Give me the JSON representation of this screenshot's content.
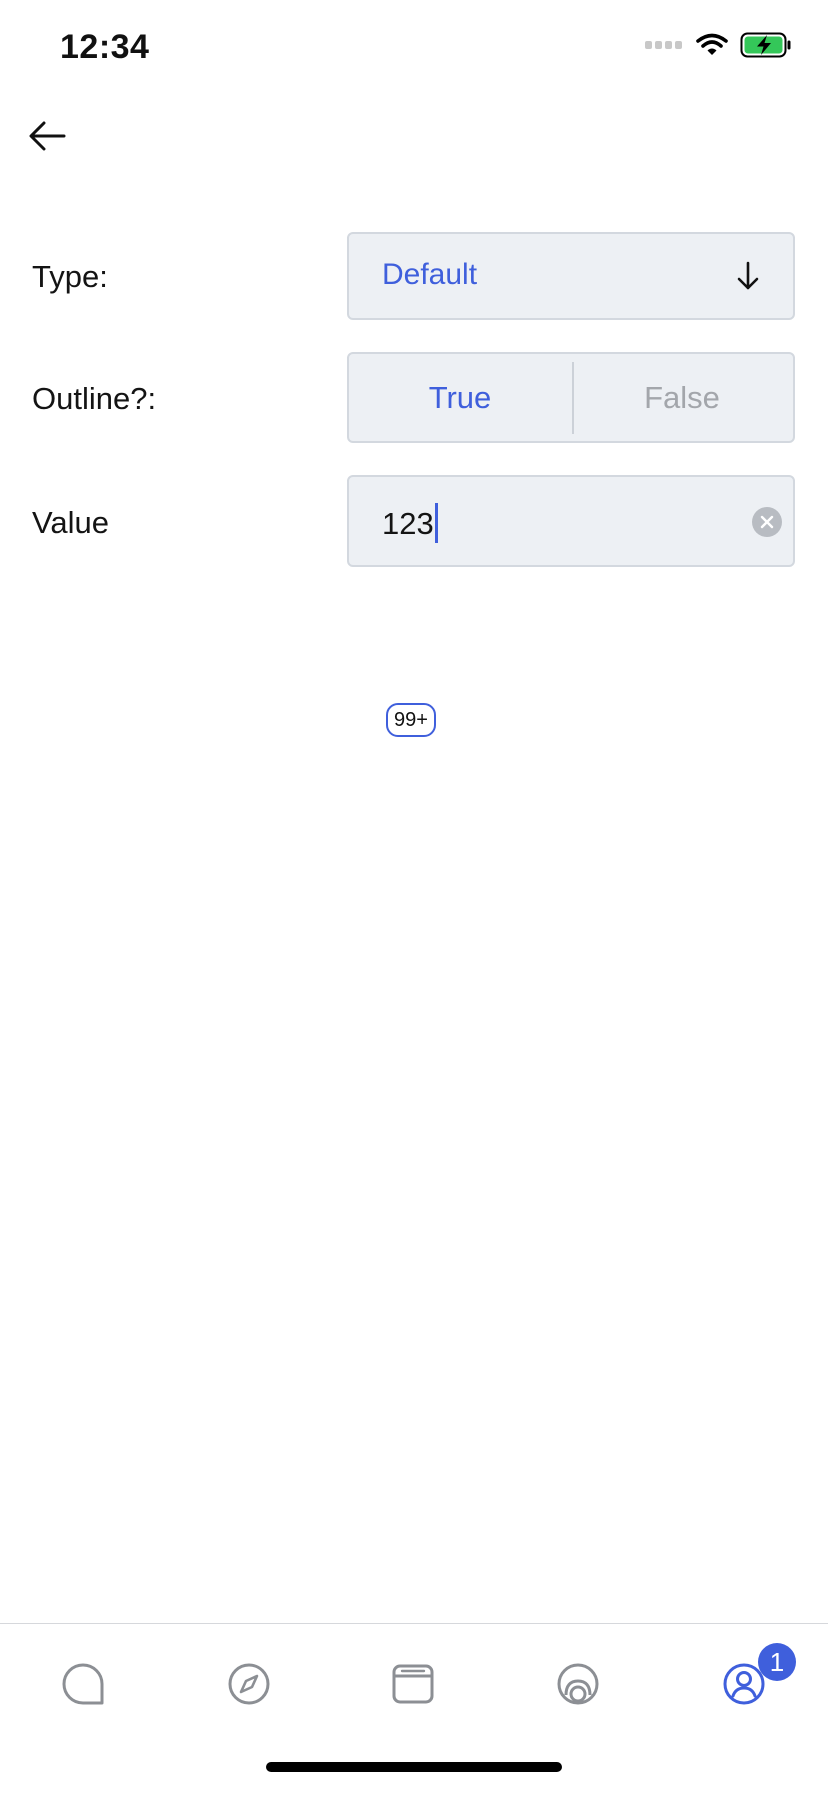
{
  "status_bar": {
    "time": "12:34"
  },
  "form": {
    "type": {
      "label": "Type:",
      "value": "Default"
    },
    "outline": {
      "label": "Outline?:",
      "options": [
        "True",
        "False"
      ],
      "selected": "True"
    },
    "value": {
      "label": "Value",
      "current_value": "123"
    }
  },
  "preview": {
    "badge_text": "99+"
  },
  "tab_bar": {
    "items": [
      {
        "icon": "chat-bubble-icon"
      },
      {
        "icon": "compass-icon"
      },
      {
        "icon": "card-window-icon"
      },
      {
        "icon": "camera-lens-icon"
      },
      {
        "icon": "user-profile-icon",
        "badge": "1",
        "active": true
      }
    ]
  },
  "colors": {
    "accent": "#3f5fdc",
    "field_background": "#edf0f4",
    "field_border": "#d3d8df",
    "inactive_text": "#a3a6ab",
    "tab_icon": "#8c8f94"
  }
}
